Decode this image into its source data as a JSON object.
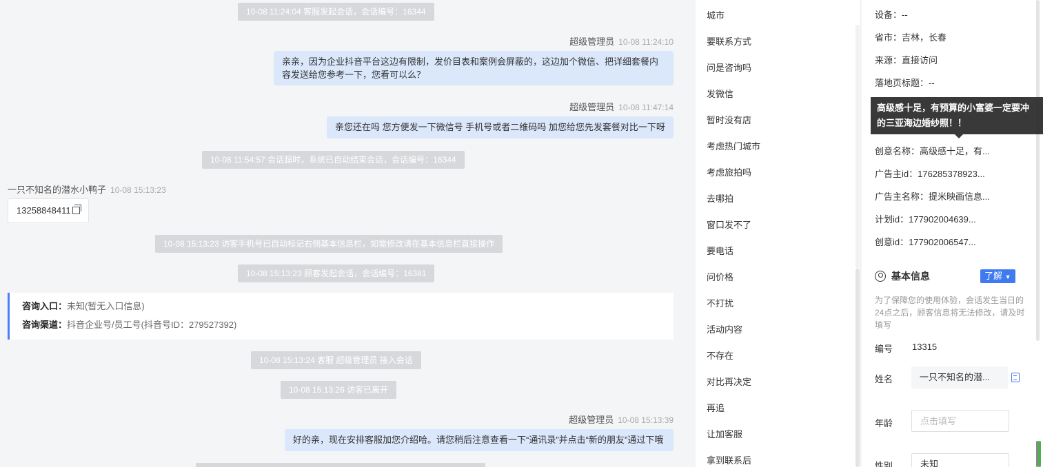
{
  "chat": {
    "sys1": "10-08 11:24:04 客服发起会话，会话编号：16344",
    "msg1_sender": "超级管理员",
    "msg1_time": "10-08 11:24:10",
    "msg1_line1": "亲亲，因为企业抖音平台这边有限制，发价目表和案例会屏蔽的，这边加个微信、把详细套餐内",
    "msg1_line2": "容发送给您参考一下，您看可以么？",
    "msg2_sender": "超级管理员",
    "msg2_time": "10-08 11:47:14",
    "msg2_text": "亲您还在吗 您方便发一下微信号 手机号或者二维码吗 加您给您先发套餐对比一下呀",
    "sys2": "10-08 11:54:57 会话超时，系统已自动结束会话，会话编号：16344",
    "visitor_name": "一只不知名的潜水小鸭子",
    "visitor_time": "10-08 15:13:23",
    "visitor_phone": "13258848411",
    "sys3": "10-08 15:13:23 访客手机号已自动标记右侧基本信息栏，如需修改请在基本信息栏直接操作",
    "sys4": "10-08 15:13:23 顾客发起会话，会话编号：16381",
    "card_entry_label": "咨询入口：",
    "card_entry_value": "未知(暂无入口信息)",
    "card_channel_label": "咨询渠道：",
    "card_channel_value": "抖音企业号/员工号(抖音号ID：279527392)",
    "sys5": "10-08 15:13:24 客服 超级管理员 接入会话",
    "sys6": "10-08 15:13:26 访客已离开",
    "msg3_sender": "超级管理员",
    "msg3_time": "10-08 15:13:39",
    "msg3_text": "好的亲，现在安排客服加您介绍哈。请您稍后注意查看一下“通讯录”并点击“新的朋友”通过下哦"
  },
  "quick_replies": [
    "城市",
    "要联系方式",
    "问是咨询吗",
    "发微信",
    "暂时没有店",
    "考虑热门城市",
    "考虑旅拍吗",
    "去哪拍",
    "窗口发不了",
    "要电话",
    "问价格",
    "不打扰",
    "活动内容",
    "不存在",
    "对比再决定",
    "再追",
    "让加客服",
    "拿到联系后"
  ],
  "info": {
    "device": "设备：--",
    "province_city": "省市：吉林，长春",
    "source": "来源：直接访问",
    "landing_title": "落地页标题：--",
    "creative_name": "创意名称：高级感十足，有...",
    "advertiser_id": "广告主id：176285378923...",
    "advertiser_name": "广告主名称：提米映画信息...",
    "plan_id": "计划id：177902004639...",
    "creative_id": "创意id：177902006547...",
    "tooltip": "高级感十足，有预算的小富婆一定要冲的三亚海边婚纱照！！",
    "basic_title": "基本信息",
    "know_button": "了解",
    "tip": "为了保障您的使用体验，会话发生当日的24点之后，顾客信息将无法修改，请及时填写",
    "id_label": "编号",
    "id_value": "13315",
    "name_label": "姓名",
    "name_value": "一只不知名的潜...",
    "age_label": "年龄",
    "age_placeholder": "点击填写",
    "gender_label": "性别",
    "gender_value": "未知"
  },
  "colors": {
    "accent": "#3f7af0",
    "bubble": "#dbe8fc",
    "system": "#d7d8db"
  }
}
